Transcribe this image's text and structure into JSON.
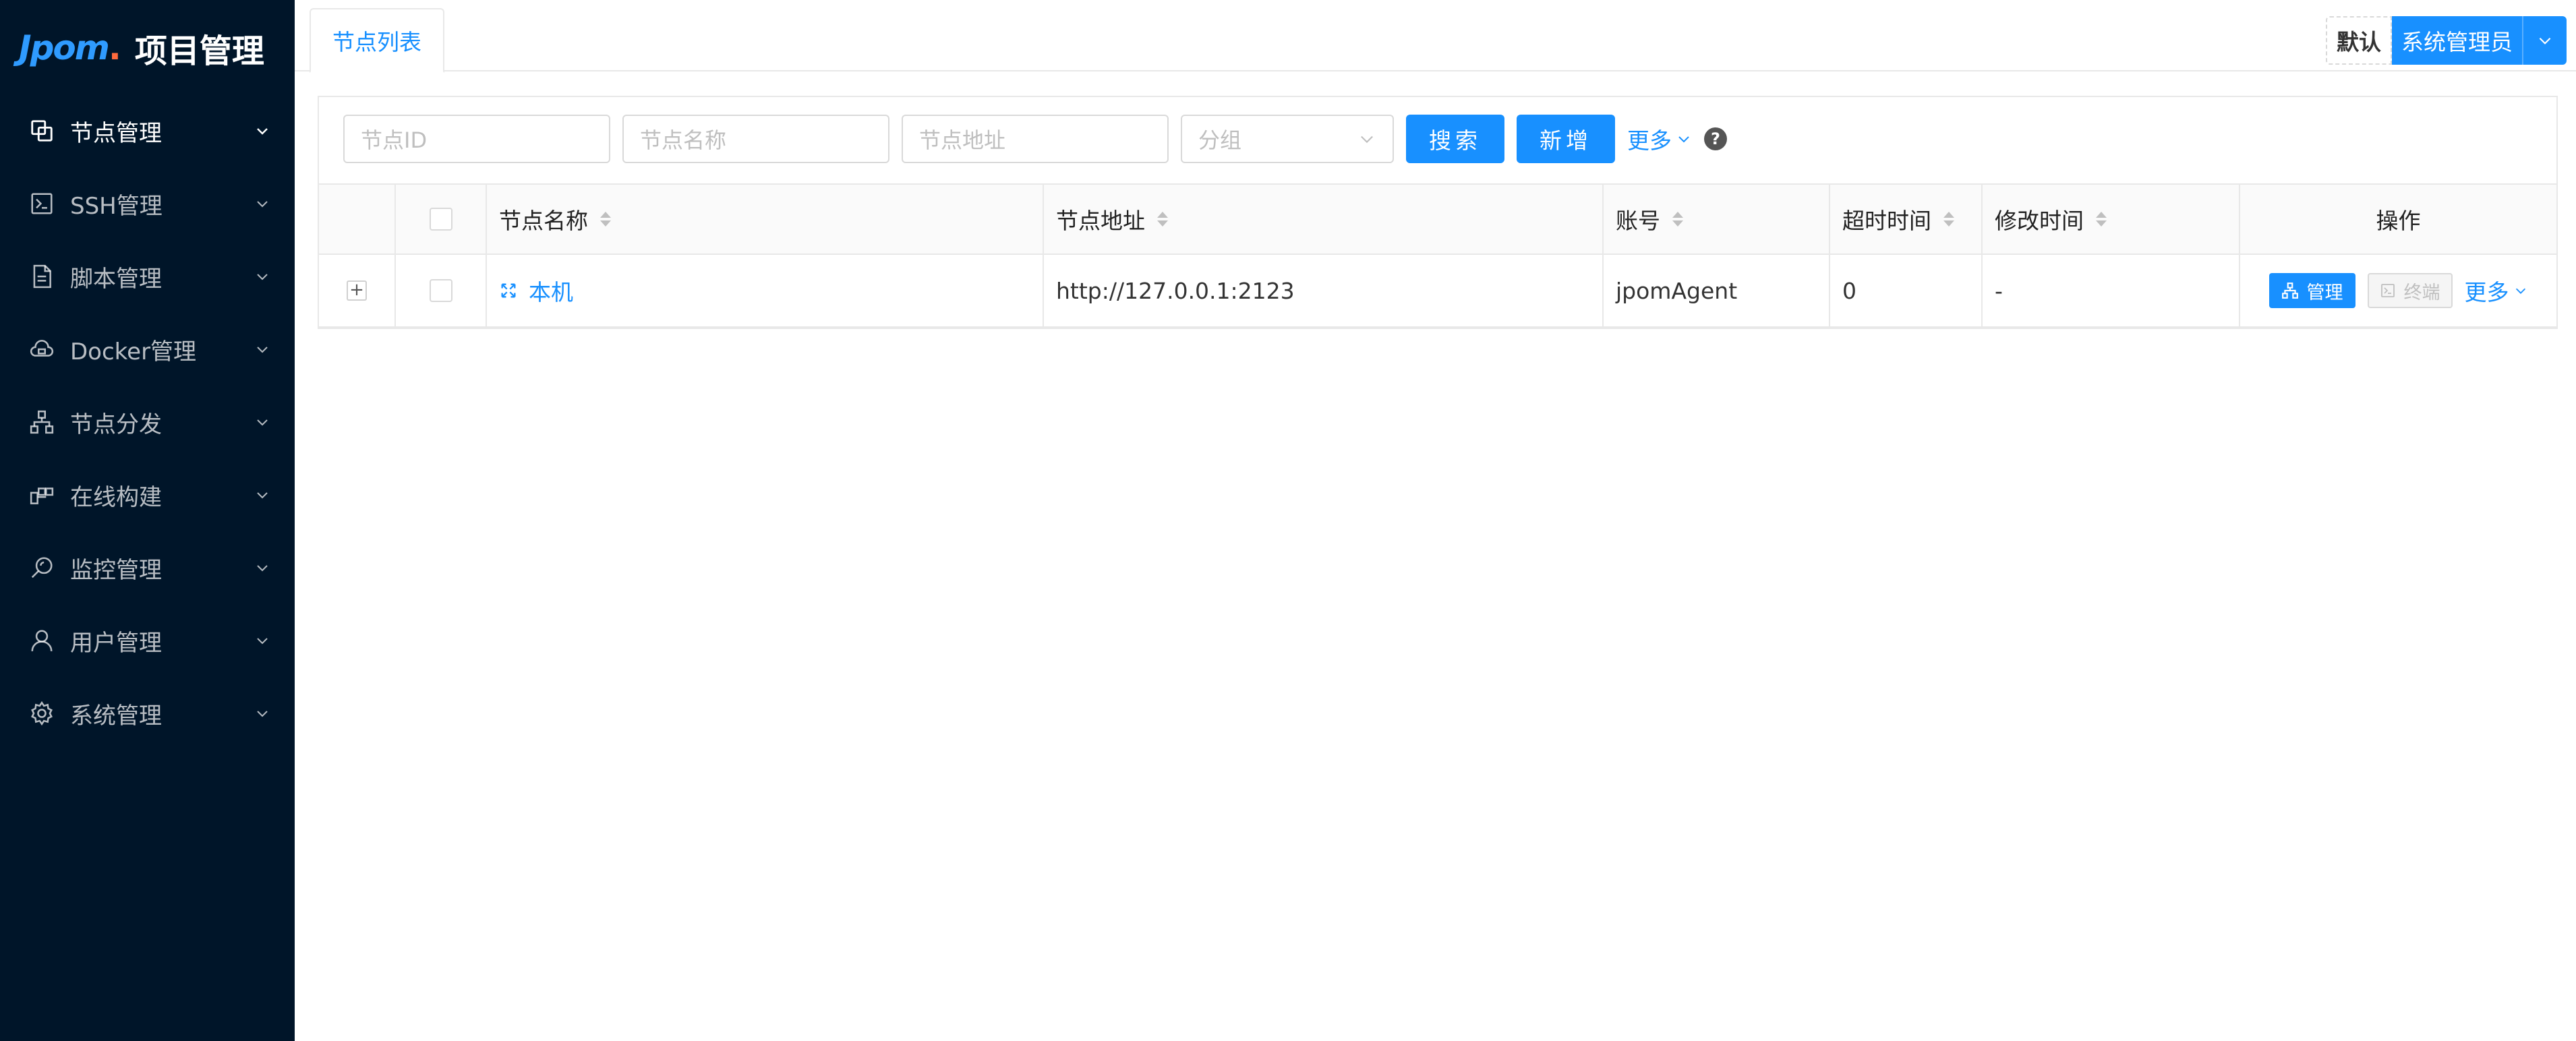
{
  "app": {
    "logo_text": "Jpom",
    "title": "项目管理"
  },
  "sidebar": {
    "items": [
      {
        "label": "节点管理",
        "icon": "nodes-icon",
        "open": true
      },
      {
        "label": "SSH管理",
        "icon": "terminal-icon"
      },
      {
        "label": "脚本管理",
        "icon": "file-icon"
      },
      {
        "label": "Docker管理",
        "icon": "cloud-icon"
      },
      {
        "label": "节点分发",
        "icon": "cluster-icon"
      },
      {
        "label": "在线构建",
        "icon": "build-icon"
      },
      {
        "label": "监控管理",
        "icon": "monitor-icon"
      },
      {
        "label": "用户管理",
        "icon": "user-icon"
      },
      {
        "label": "系统管理",
        "icon": "settings-icon"
      }
    ]
  },
  "topbar": {
    "tab_label": "节点列表",
    "workspace_label": "默认",
    "user_label": "系统管理员"
  },
  "filters": {
    "node_id_placeholder": "节点ID",
    "node_name_placeholder": "节点名称",
    "node_address_placeholder": "节点地址",
    "group_placeholder": "分组",
    "search_label": "搜索",
    "add_label": "新增",
    "more_label": "更多"
  },
  "table": {
    "columns": [
      "节点名称",
      "节点地址",
      "账号",
      "超时时间",
      "修改时间",
      "操作"
    ],
    "rows": [
      {
        "name": "本机",
        "address": "http://127.0.0.1:2123",
        "account": "jpomAgent",
        "timeout": "0",
        "modified": "-",
        "op_manage": "管理",
        "op_terminal": "终端",
        "op_more": "更多"
      }
    ]
  },
  "colors": {
    "sidebar_bg": "#001529",
    "primary": "#1890ff",
    "logo_accent": "#ff6a3d"
  }
}
